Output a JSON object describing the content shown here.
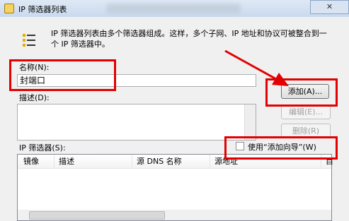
{
  "window": {
    "title": "IP 筛选器列表",
    "close_label": "✕"
  },
  "description": "IP 筛选器列表由多个筛选器组成。这样，多个子网、IP 地址和协议可被整合到一个 IP 筛选器中。",
  "name_field": {
    "label": "名称(N):",
    "value": "封端口"
  },
  "desc_field": {
    "label": "描述(D):",
    "value": ""
  },
  "buttons": {
    "add": "添加(A)...",
    "edit": "编辑(E)...",
    "delete": "删除(R)"
  },
  "filters": {
    "label": "IP 筛选器(S):",
    "wizard_label": "使用“添加向导”(W)",
    "wizard_checked": false,
    "columns": [
      "镜像",
      "描述",
      "源 DNS 名称",
      "源地址",
      "目"
    ]
  },
  "colors": {
    "annotation_red": "#e30000",
    "titlebar": "#dfe9f5"
  },
  "icons": [
    "filter-list-icon",
    "window-icon",
    "close-icon",
    "checkbox-icon"
  ]
}
